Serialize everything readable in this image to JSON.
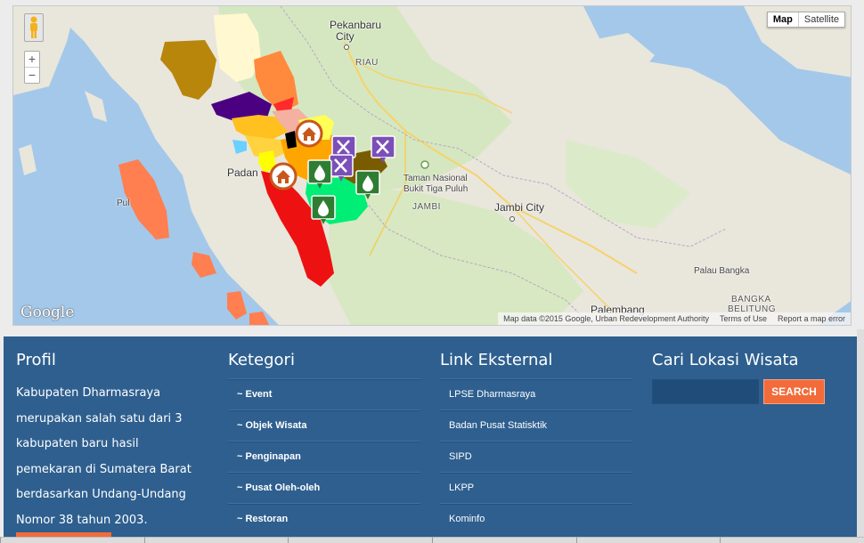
{
  "map": {
    "type_buttons": {
      "map": "Map",
      "satellite": "Satellite"
    },
    "zoom": {
      "in": "+",
      "out": "−"
    },
    "labels": {
      "pekanbaru": "Pekanbaru",
      "city": "City",
      "riau": "RIAU",
      "padang": "Padan",
      "taman1": "Taman Nasional",
      "taman2": "Bukit Tiga Puluh",
      "jambi": "JAMBI",
      "jambi_city": "Jambi City",
      "palau_bangka": "Palau Bangka",
      "bangka1": "BANGKA",
      "bangka2": "BELITUNG",
      "palembang": "Palembang",
      "pulau": "Pul"
    },
    "logo": "Google",
    "attribution": {
      "data": "Map data ©2015 Google, Urban Redevelopment Authority",
      "terms": "Terms of Use",
      "report": "Report a map error"
    },
    "colors": {
      "water": "#a4c8ea",
      "land": "#e9e6dc",
      "green": "#cfe6b5",
      "marker_home": "#c8571c",
      "marker_food": "#7b4fb8",
      "marker_drop": "#2e7d32"
    }
  },
  "footer": {
    "profil": {
      "title": "Profil",
      "text": "Kabupaten Dharmasraya merupakan salah satu dari 3 kabupaten baru hasil pemekaran di Sumatera Barat berdasarkan Undang-Undang Nomor 38 tahun 2003."
    },
    "kategori": {
      "title": "Ketegori",
      "items": [
        "~ Event",
        "~ Objek Wisata",
        "~ Penginapan",
        "~ Pusat Oleh-oleh",
        "~ Restoran"
      ]
    },
    "link": {
      "title": "Link Eksternal",
      "items": [
        "LPSE Dharmasraya",
        "Badan Pusat Statisktik",
        "SIPD",
        "LKPP",
        "Kominfo"
      ]
    },
    "cari": {
      "title": "Cari Lokasi Wisata",
      "input_value": "",
      "button": "SEARCH"
    }
  }
}
